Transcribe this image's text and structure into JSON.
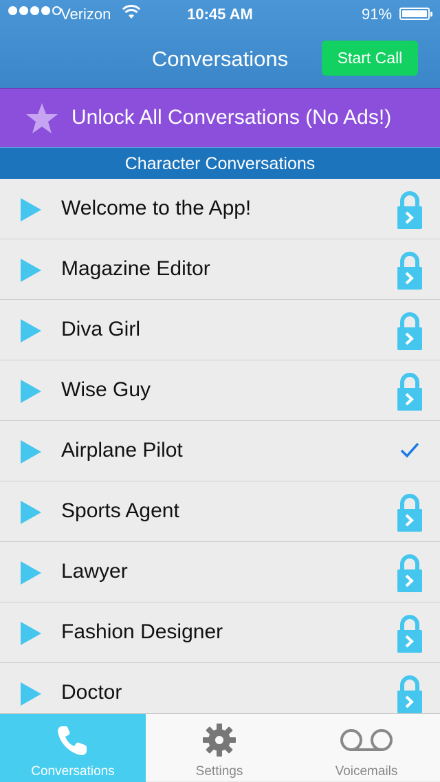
{
  "status_bar": {
    "carrier": "Verizon",
    "time": "10:45 AM",
    "battery": "91%",
    "signal_bars_filled": 4,
    "signal_bars_total": 5
  },
  "nav": {
    "title": "Conversations",
    "start_call_label": "Start Call"
  },
  "banner": {
    "label": "Unlock All Conversations (No Ads!)",
    "icon": "star-icon"
  },
  "section": {
    "title": "Character Conversations"
  },
  "conversations": [
    {
      "name": "Welcome to the App!",
      "status": "locked"
    },
    {
      "name": "Magazine Editor",
      "status": "locked"
    },
    {
      "name": "Diva Girl",
      "status": "locked"
    },
    {
      "name": "Wise Guy",
      "status": "locked"
    },
    {
      "name": "Airplane Pilot",
      "status": "selected"
    },
    {
      "name": "Sports Agent",
      "status": "locked"
    },
    {
      "name": "Lawyer",
      "status": "locked"
    },
    {
      "name": "Fashion Designer",
      "status": "locked"
    },
    {
      "name": "Doctor",
      "status": "locked"
    }
  ],
  "tabs": [
    {
      "label": "Conversations",
      "icon": "phone-icon",
      "active": true
    },
    {
      "label": "Settings",
      "icon": "gear-icon",
      "active": false
    },
    {
      "label": "Voicemails",
      "icon": "voicemail-icon",
      "active": false
    }
  ],
  "colors": {
    "header": "#3a86c8",
    "start_call": "#13d160",
    "banner": "#8b4fdc",
    "section": "#1c74bd",
    "accent": "#46cdef",
    "checkmark": "#1a7ae8"
  }
}
